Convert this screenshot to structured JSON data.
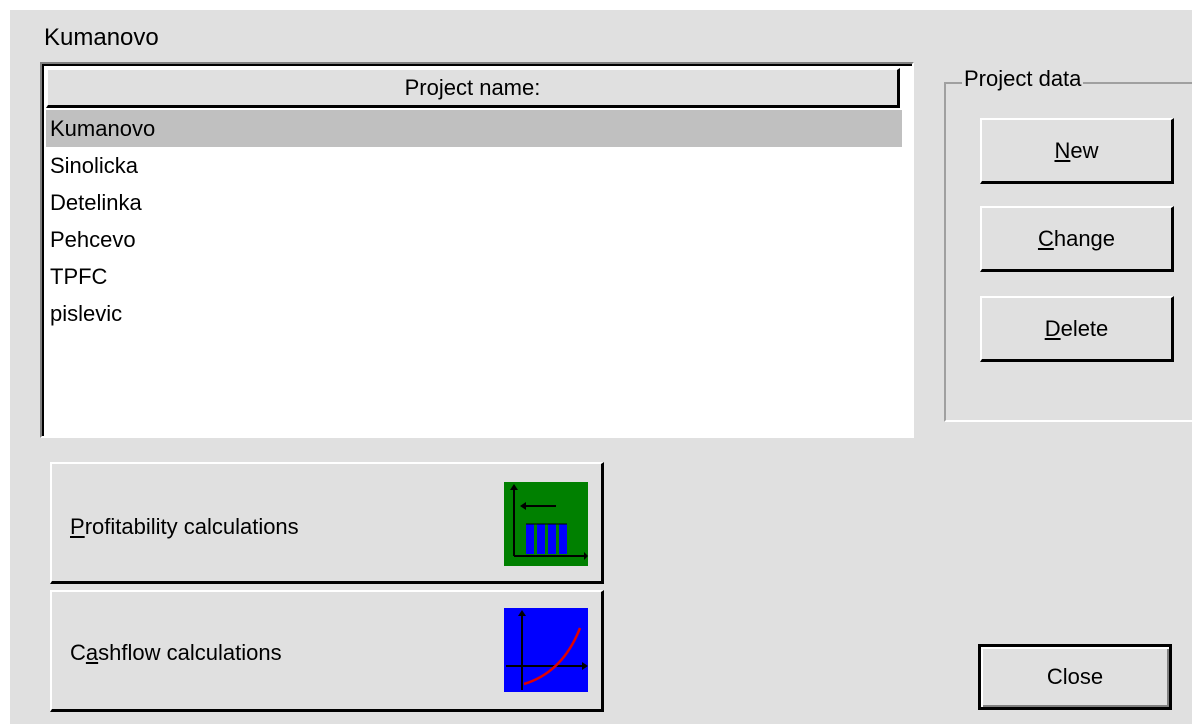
{
  "dialog": {
    "title": "Kumanovo"
  },
  "project_list": {
    "header": "Project name:",
    "items": [
      "Kumanovo",
      "Sinolicka",
      "Detelinka",
      "Pehcevo",
      "TPFC",
      "pislevic"
    ],
    "selected_index": 0
  },
  "project_data": {
    "group_label": "Project data",
    "new_label_u": "N",
    "new_label_rest": "ew",
    "change_label_u": "C",
    "change_label_rest": "hange",
    "delete_label_u": "D",
    "delete_label_rest": "elete"
  },
  "calculations": {
    "profit_label_u": "P",
    "profit_label_rest": "rofitability calculations",
    "profit_icon": "bar-chart-icon",
    "profit_icon_color": "#008000",
    "cash_label_pre": "C",
    "cash_label_u": "a",
    "cash_label_rest": "shflow calculations",
    "cash_icon": "curve-chart-icon",
    "cash_icon_color": "#0000ff"
  },
  "close_label": "Close"
}
